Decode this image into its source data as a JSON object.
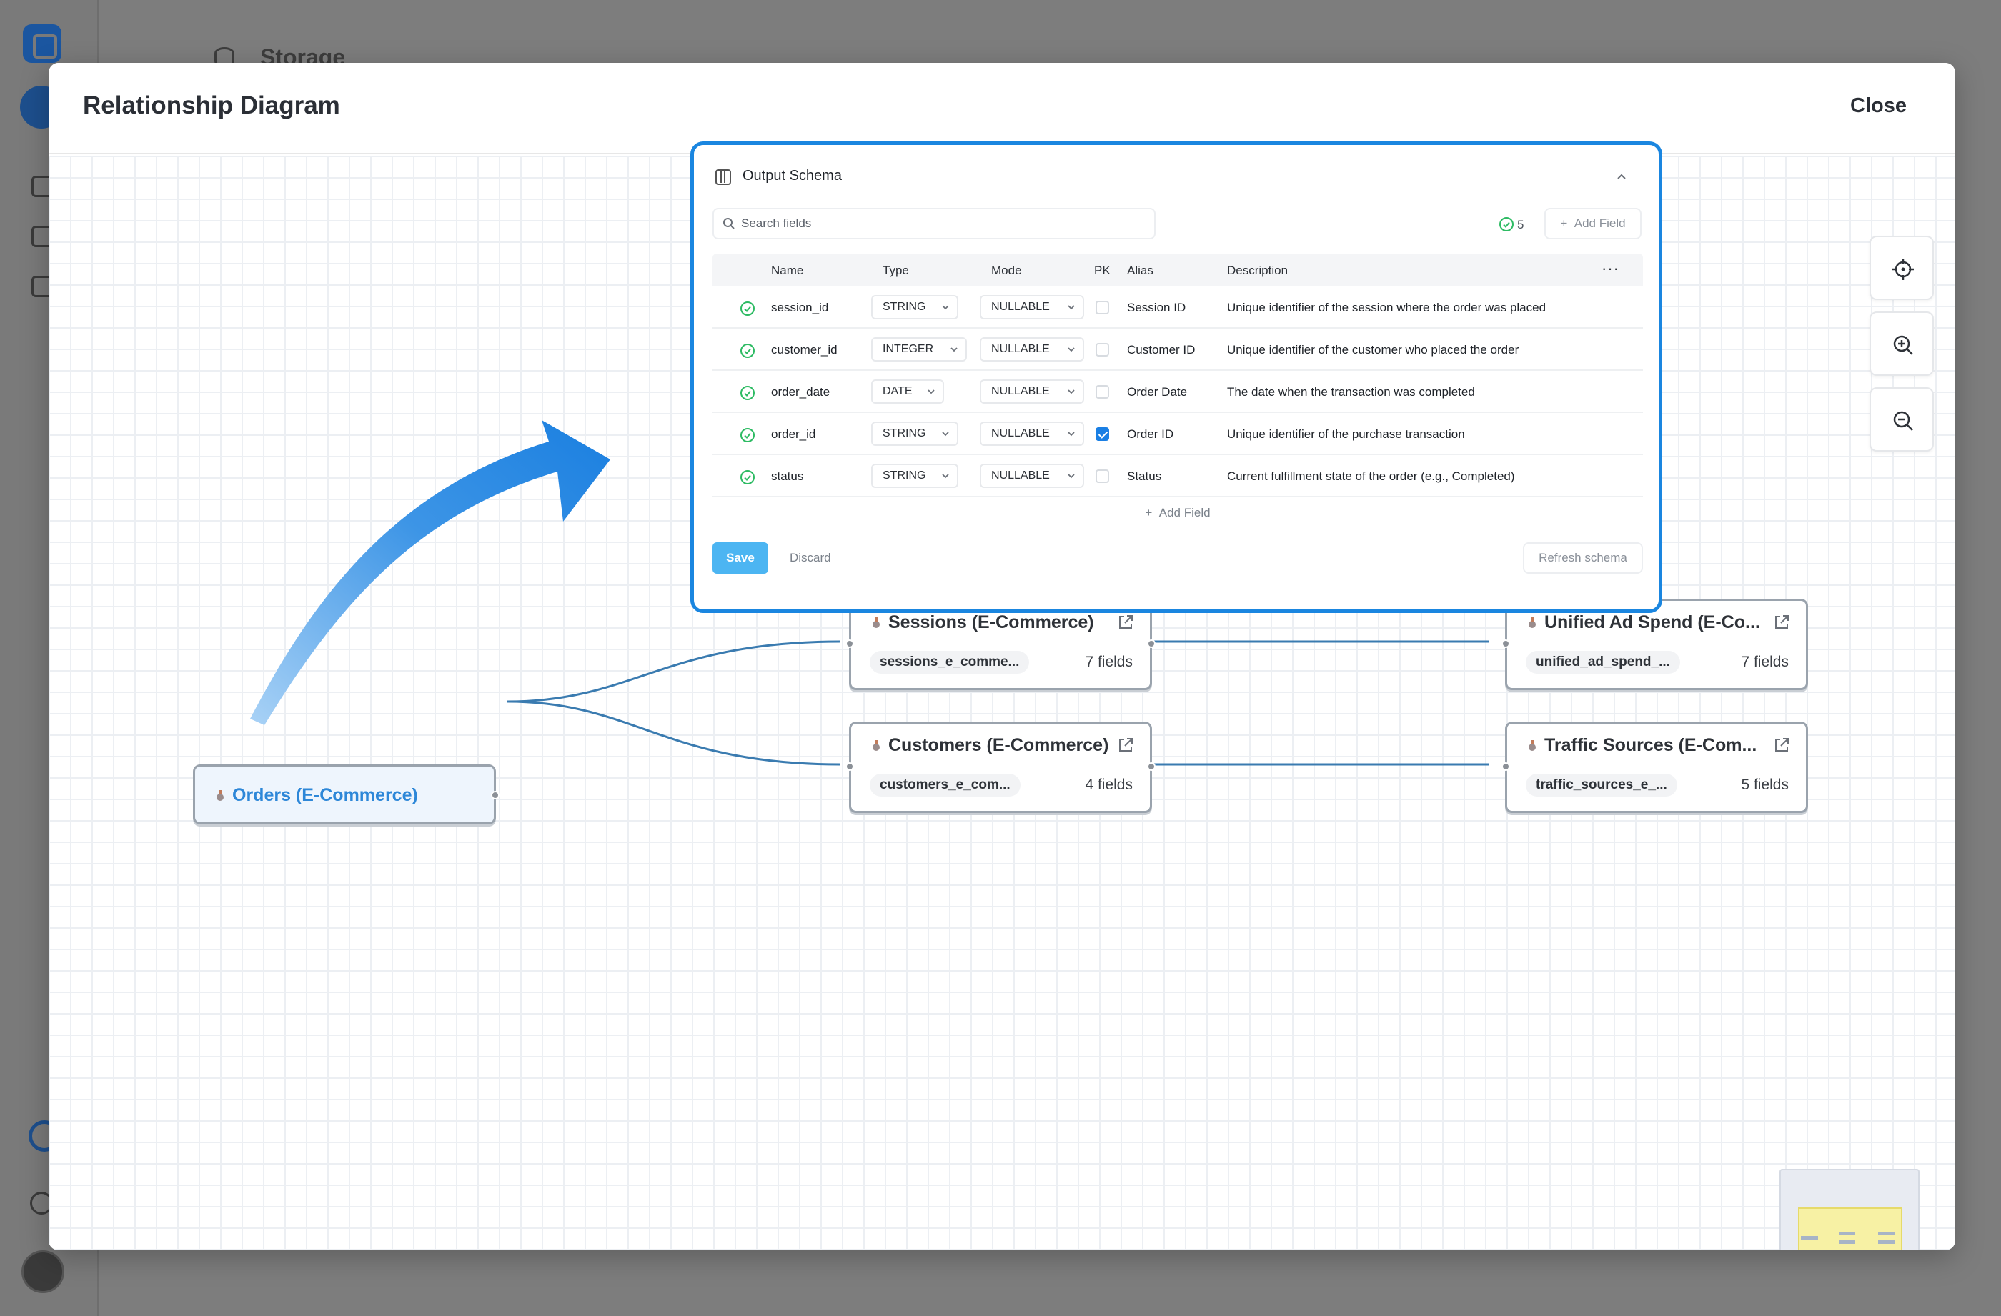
{
  "background_app": {
    "section_title": "Storage"
  },
  "modal": {
    "title": "Relationship Diagram",
    "close_label": "Close"
  },
  "schema_panel": {
    "title": "Output Schema",
    "search_placeholder": "Search fields",
    "valid_count": "5",
    "add_field_label": "Add Field",
    "columns": [
      "Name",
      "Type",
      "Mode",
      "PK",
      "Alias",
      "Description"
    ],
    "rows": [
      {
        "name": "session_id",
        "type": "STRING",
        "mode": "NULLABLE",
        "pk": false,
        "alias": "Session ID",
        "description": "Unique identifier of the session where the order was placed"
      },
      {
        "name": "customer_id",
        "type": "INTEGER",
        "mode": "NULLABLE",
        "pk": false,
        "alias": "Customer ID",
        "description": "Unique identifier of the customer who placed the order"
      },
      {
        "name": "order_date",
        "type": "DATE",
        "mode": "NULLABLE",
        "pk": false,
        "alias": "Order Date",
        "description": "The date when the transaction was completed"
      },
      {
        "name": "order_id",
        "type": "STRING",
        "mode": "NULLABLE",
        "pk": true,
        "alias": "Order ID",
        "description": "Unique identifier of the purchase transaction"
      },
      {
        "name": "status",
        "type": "STRING",
        "mode": "NULLABLE",
        "pk": false,
        "alias": "Status",
        "description": "Current fulfillment state of the order (e.g., Completed)"
      }
    ],
    "add_field_row_label": "Add Field",
    "save_label": "Save",
    "discard_label": "Discard",
    "refresh_label": "Refresh schema"
  },
  "nodes": {
    "orders": {
      "title": "Orders (E-Commerce)"
    },
    "sessions": {
      "title": "Sessions (E-Commerce)",
      "table": "sessions_e_comme...",
      "fields": "7 fields"
    },
    "customers": {
      "title": "Customers (E-Commerce)",
      "table": "customers_e_com...",
      "fields": "4 fields"
    },
    "unified_ad_spend": {
      "title": "Unified Ad Spend (E-Co...",
      "table": "unified_ad_spend_...",
      "fields": "7 fields"
    },
    "traffic_sources": {
      "title": "Traffic Sources (E-Com...",
      "table": "traffic_sources_e_...",
      "fields": "5 fields"
    }
  },
  "icons": {
    "controls": [
      "crosshair-icon",
      "zoom-in-icon",
      "zoom-out-icon"
    ],
    "node_pin": "pin-icon",
    "node_open": "external-link-icon",
    "row_status": "check-circle-icon"
  },
  "colors": {
    "accent": "#1a86e0",
    "save_button": "#4cb5f2",
    "edge": "#3a7bb0",
    "valid_green": "#2dbb63",
    "orders_title": "#2d87d8"
  }
}
